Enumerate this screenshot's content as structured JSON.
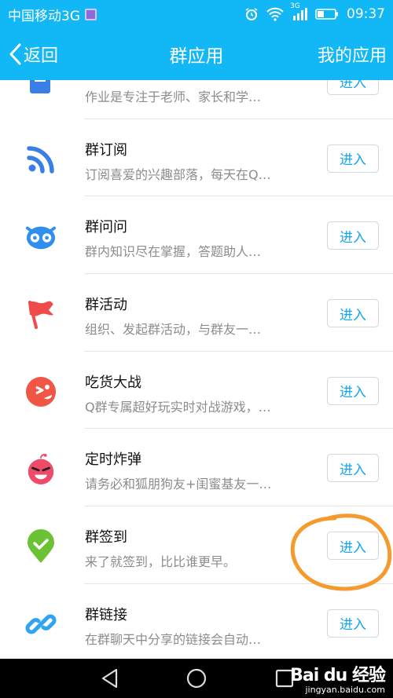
{
  "status_bar": {
    "carrier": "中国移动3G",
    "network": "3G",
    "time": "09:37"
  },
  "title_bar": {
    "back_label": "返回",
    "title": "群应用",
    "my_apps_label": "我的应用"
  },
  "apps": [
    {
      "name": "",
      "desc": "作业是专注于老师、家长和学…",
      "icon": "homework-icon",
      "color": "#3a7fe6"
    },
    {
      "name": "群订阅",
      "desc": "订阅喜爱的兴趣部落，每天在Q…",
      "icon": "rss-feed-icon",
      "color": "#3a7fe6"
    },
    {
      "name": "群问问",
      "desc": "群内知识尽在掌握，答题助人…",
      "icon": "owl-icon",
      "color": "#2f8ef0"
    },
    {
      "name": "群活动",
      "desc": "组织、发起群活动，与群友一…",
      "icon": "flag-icon",
      "color": "#f04b4b"
    },
    {
      "name": "吃货大战",
      "desc": "Q群专属超好玩实时对战游戏，…",
      "icon": "foodie-face-icon",
      "color": "#f05545"
    },
    {
      "name": "定时炸弹",
      "desc": "请务必和狐朋狗友+闺蜜基友一…",
      "icon": "bomb-face-icon",
      "color": "#f04a6a"
    },
    {
      "name": "群签到",
      "desc": "来了就签到，比比谁更早。",
      "icon": "checkin-pin-icon",
      "color": "#6cc235"
    },
    {
      "name": "群链接",
      "desc": "在群聊天中分享的链接会自动…",
      "icon": "link-icon",
      "color": "#2fa4f0"
    }
  ],
  "enter_label": "进入",
  "watermark": {
    "brand": "Bai du 经验",
    "url": "jingyan.baidu.com"
  }
}
